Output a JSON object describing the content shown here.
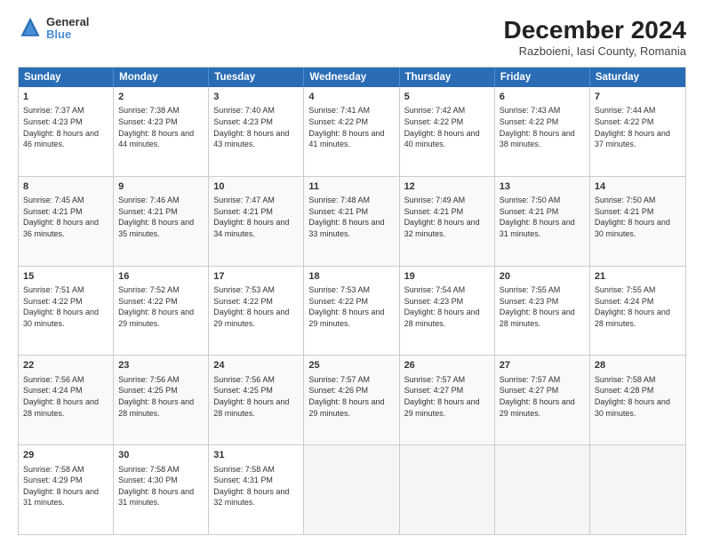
{
  "header": {
    "logo_line1": "General",
    "logo_line2": "Blue",
    "title": "December 2024",
    "subtitle": "Razboieni, Iasi County, Romania"
  },
  "calendar": {
    "weekdays": [
      "Sunday",
      "Monday",
      "Tuesday",
      "Wednesday",
      "Thursday",
      "Friday",
      "Saturday"
    ],
    "rows": [
      [
        {
          "day": "1",
          "sunrise": "7:37 AM",
          "sunset": "4:23 PM",
          "daylight": "8 hours and 46 minutes."
        },
        {
          "day": "2",
          "sunrise": "7:38 AM",
          "sunset": "4:23 PM",
          "daylight": "8 hours and 44 minutes."
        },
        {
          "day": "3",
          "sunrise": "7:40 AM",
          "sunset": "4:23 PM",
          "daylight": "8 hours and 43 minutes."
        },
        {
          "day": "4",
          "sunrise": "7:41 AM",
          "sunset": "4:22 PM",
          "daylight": "8 hours and 41 minutes."
        },
        {
          "day": "5",
          "sunrise": "7:42 AM",
          "sunset": "4:22 PM",
          "daylight": "8 hours and 40 minutes."
        },
        {
          "day": "6",
          "sunrise": "7:43 AM",
          "sunset": "4:22 PM",
          "daylight": "8 hours and 38 minutes."
        },
        {
          "day": "7",
          "sunrise": "7:44 AM",
          "sunset": "4:22 PM",
          "daylight": "8 hours and 37 minutes."
        }
      ],
      [
        {
          "day": "8",
          "sunrise": "7:45 AM",
          "sunset": "4:21 PM",
          "daylight": "8 hours and 36 minutes."
        },
        {
          "day": "9",
          "sunrise": "7:46 AM",
          "sunset": "4:21 PM",
          "daylight": "8 hours and 35 minutes."
        },
        {
          "day": "10",
          "sunrise": "7:47 AM",
          "sunset": "4:21 PM",
          "daylight": "8 hours and 34 minutes."
        },
        {
          "day": "11",
          "sunrise": "7:48 AM",
          "sunset": "4:21 PM",
          "daylight": "8 hours and 33 minutes."
        },
        {
          "day": "12",
          "sunrise": "7:49 AM",
          "sunset": "4:21 PM",
          "daylight": "8 hours and 32 minutes."
        },
        {
          "day": "13",
          "sunrise": "7:50 AM",
          "sunset": "4:21 PM",
          "daylight": "8 hours and 31 minutes."
        },
        {
          "day": "14",
          "sunrise": "7:50 AM",
          "sunset": "4:21 PM",
          "daylight": "8 hours and 30 minutes."
        }
      ],
      [
        {
          "day": "15",
          "sunrise": "7:51 AM",
          "sunset": "4:22 PM",
          "daylight": "8 hours and 30 minutes."
        },
        {
          "day": "16",
          "sunrise": "7:52 AM",
          "sunset": "4:22 PM",
          "daylight": "8 hours and 29 minutes."
        },
        {
          "day": "17",
          "sunrise": "7:53 AM",
          "sunset": "4:22 PM",
          "daylight": "8 hours and 29 minutes."
        },
        {
          "day": "18",
          "sunrise": "7:53 AM",
          "sunset": "4:22 PM",
          "daylight": "8 hours and 29 minutes."
        },
        {
          "day": "19",
          "sunrise": "7:54 AM",
          "sunset": "4:23 PM",
          "daylight": "8 hours and 28 minutes."
        },
        {
          "day": "20",
          "sunrise": "7:55 AM",
          "sunset": "4:23 PM",
          "daylight": "8 hours and 28 minutes."
        },
        {
          "day": "21",
          "sunrise": "7:55 AM",
          "sunset": "4:24 PM",
          "daylight": "8 hours and 28 minutes."
        }
      ],
      [
        {
          "day": "22",
          "sunrise": "7:56 AM",
          "sunset": "4:24 PM",
          "daylight": "8 hours and 28 minutes."
        },
        {
          "day": "23",
          "sunrise": "7:56 AM",
          "sunset": "4:25 PM",
          "daylight": "8 hours and 28 minutes."
        },
        {
          "day": "24",
          "sunrise": "7:56 AM",
          "sunset": "4:25 PM",
          "daylight": "8 hours and 28 minutes."
        },
        {
          "day": "25",
          "sunrise": "7:57 AM",
          "sunset": "4:26 PM",
          "daylight": "8 hours and 29 minutes."
        },
        {
          "day": "26",
          "sunrise": "7:57 AM",
          "sunset": "4:27 PM",
          "daylight": "8 hours and 29 minutes."
        },
        {
          "day": "27",
          "sunrise": "7:57 AM",
          "sunset": "4:27 PM",
          "daylight": "8 hours and 29 minutes."
        },
        {
          "day": "28",
          "sunrise": "7:58 AM",
          "sunset": "4:28 PM",
          "daylight": "8 hours and 30 minutes."
        }
      ],
      [
        {
          "day": "29",
          "sunrise": "7:58 AM",
          "sunset": "4:29 PM",
          "daylight": "8 hours and 31 minutes."
        },
        {
          "day": "30",
          "sunrise": "7:58 AM",
          "sunset": "4:30 PM",
          "daylight": "8 hours and 31 minutes."
        },
        {
          "day": "31",
          "sunrise": "7:58 AM",
          "sunset": "4:31 PM",
          "daylight": "8 hours and 32 minutes."
        },
        null,
        null,
        null,
        null
      ]
    ]
  }
}
